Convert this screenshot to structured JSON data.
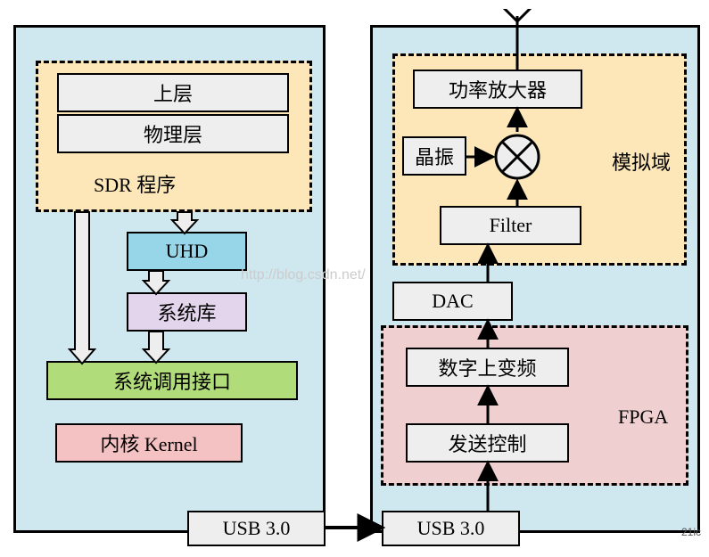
{
  "diagram": {
    "left": {
      "upper_layer": "上层",
      "physical_layer": "物理层",
      "sdr_program": "SDR 程序",
      "uhd": "UHD",
      "sys_lib": "系统库",
      "syscall_if": "系统调用接口",
      "kernel": "内核 Kernel",
      "usb": "USB 3.0"
    },
    "right": {
      "power_amp": "功率放大器",
      "crystal": "晶振",
      "filter": "Filter",
      "analog_domain": "模拟域",
      "dac": "DAC",
      "duc": "数字上变频",
      "tx_ctrl": "发送控制",
      "fpga": "FPGA",
      "usb": "USB 3.0"
    },
    "watermark": "http://blog.csdn.net/",
    "corner": "21ic"
  }
}
